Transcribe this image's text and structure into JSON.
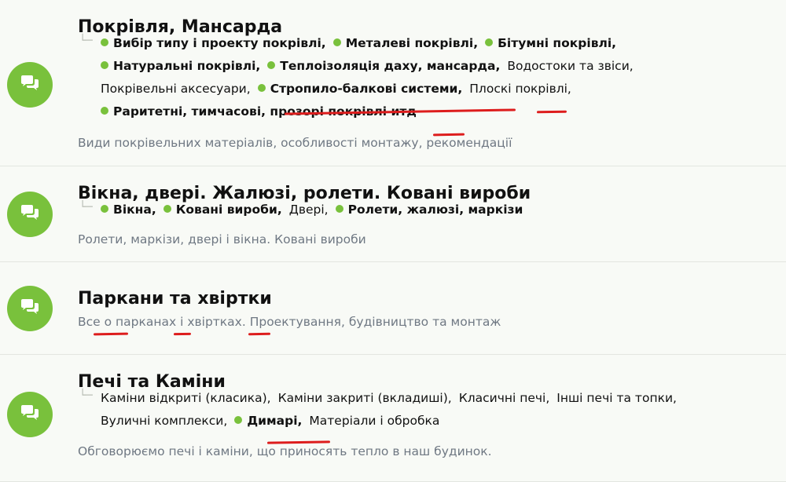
{
  "forums": [
    {
      "title": "Покрівля, Мансарда",
      "subforums": [
        {
          "label": "Вибір типу і проекту покрівлі,",
          "unread": true
        },
        {
          "label": "Металеві покрівлі,",
          "unread": true
        },
        {
          "label": "Бітумні покрівлі,",
          "unread": true
        },
        {
          "label": "Натуральні покрівлі,",
          "unread": true
        },
        {
          "label": "Теплоізоляція даху, мансарда,",
          "unread": true
        },
        {
          "label": "Водостоки та звіси,",
          "unread": false
        },
        {
          "label": "Покрівельні аксесуари,",
          "unread": false
        },
        {
          "label": "Стропило-балкові системи,",
          "unread": true
        },
        {
          "label": "Плоскі покрівлі,",
          "unread": false
        },
        {
          "label": "Раритетні, тимчасові, прозорі покрівлі итд",
          "unread": true
        }
      ],
      "description": "Види покрівельних матеріалів, особливості монтажу, рекомендації"
    },
    {
      "title": "Вікна, двері. Жалюзі, ролети. Ковані вироби",
      "subforums": [
        {
          "label": "Вікна,",
          "unread": true
        },
        {
          "label": "Ковані вироби,",
          "unread": true
        },
        {
          "label": "Двері,",
          "unread": false
        },
        {
          "label": "Ролети, жалюзі, маркізи",
          "unread": true
        }
      ],
      "description": "Ролети, маркізи, двері і вікна. Ковані вироби"
    },
    {
      "title": "Паркани та хвіртки",
      "subforums": [],
      "description": "Все о парканах і хвіртках. Проектування, будівництво та монтаж"
    },
    {
      "title": "Печі та Каміни",
      "subforums": [
        {
          "label": "Каміни відкриті (класика),",
          "unread": false
        },
        {
          "label": "Каміни закриті (вкладиші),",
          "unread": false
        },
        {
          "label": "Класичні печі,",
          "unread": false
        },
        {
          "label": "Інші печі та топки,",
          "unread": false
        },
        {
          "label": "Вуличні комплекси,",
          "unread": false
        },
        {
          "label": "Димарі,",
          "unread": true
        },
        {
          "label": "Матеріали і обробка",
          "unread": false
        }
      ],
      "description": "Обговорюємо печі і каміни, що приносять тепло в наш будинок."
    }
  ],
  "colors": {
    "accent": "#79c13c",
    "annotation": "#dd1d1d",
    "description": "#6f7883"
  },
  "icons": {
    "forum_icon": "speech-bubbles-icon"
  }
}
